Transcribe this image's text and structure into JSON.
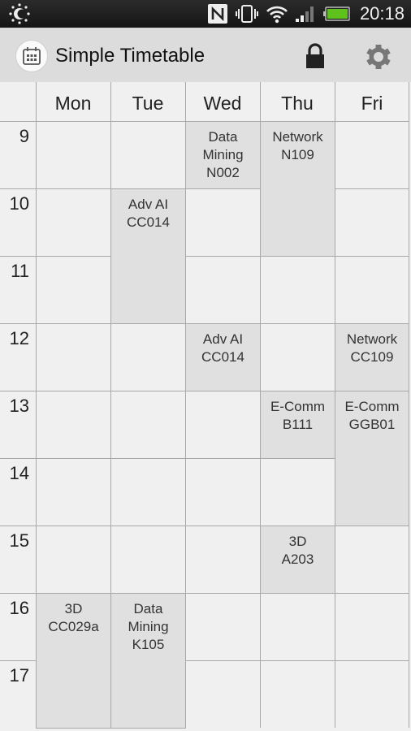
{
  "status_bar": {
    "time": "20:18",
    "icons": [
      "brightness-icon",
      "nfc-icon",
      "vibrate-icon",
      "wifi-icon",
      "signal-icon",
      "battery-icon"
    ],
    "battery_color": "#5ec11c"
  },
  "action_bar": {
    "title": "Simple Timetable",
    "icons": [
      "calendar-app-icon",
      "lock-icon",
      "settings-gear-icon"
    ]
  },
  "timetable": {
    "days": [
      "Mon",
      "Tue",
      "Wed",
      "Thu",
      "Fri"
    ],
    "hours": [
      "9",
      "10",
      "11",
      "12",
      "13",
      "14",
      "15",
      "16",
      "17"
    ],
    "events": [
      {
        "day": 2,
        "start": 9,
        "end": 10,
        "lines": [
          "Data",
          "Mining",
          "N002"
        ]
      },
      {
        "day": 3,
        "start": 9,
        "end": 11,
        "lines": [
          "Network",
          "N109"
        ]
      },
      {
        "day": 1,
        "start": 10,
        "end": 12,
        "lines": [
          "Adv AI",
          "CC014"
        ]
      },
      {
        "day": 2,
        "start": 12,
        "end": 13,
        "lines": [
          "Adv AI",
          "CC014"
        ]
      },
      {
        "day": 4,
        "start": 12,
        "end": 13,
        "lines": [
          "Network",
          "CC109"
        ]
      },
      {
        "day": 3,
        "start": 13,
        "end": 14,
        "lines": [
          "E-Comm",
          "B111"
        ]
      },
      {
        "day": 4,
        "start": 13,
        "end": 15,
        "lines": [
          "E-Comm",
          "GGB01"
        ]
      },
      {
        "day": 3,
        "start": 15,
        "end": 16,
        "lines": [
          "3D",
          "A203"
        ]
      },
      {
        "day": 0,
        "start": 16,
        "end": 18,
        "lines": [
          "3D",
          "CC029a"
        ]
      },
      {
        "day": 1,
        "start": 16,
        "end": 18,
        "lines": [
          "Data",
          "Mining",
          "K105"
        ]
      }
    ],
    "colors": {
      "cell_bg": "#f0f0f0",
      "event_bg": "#e0e0e0",
      "grid_line": "#a8a8a8"
    }
  }
}
